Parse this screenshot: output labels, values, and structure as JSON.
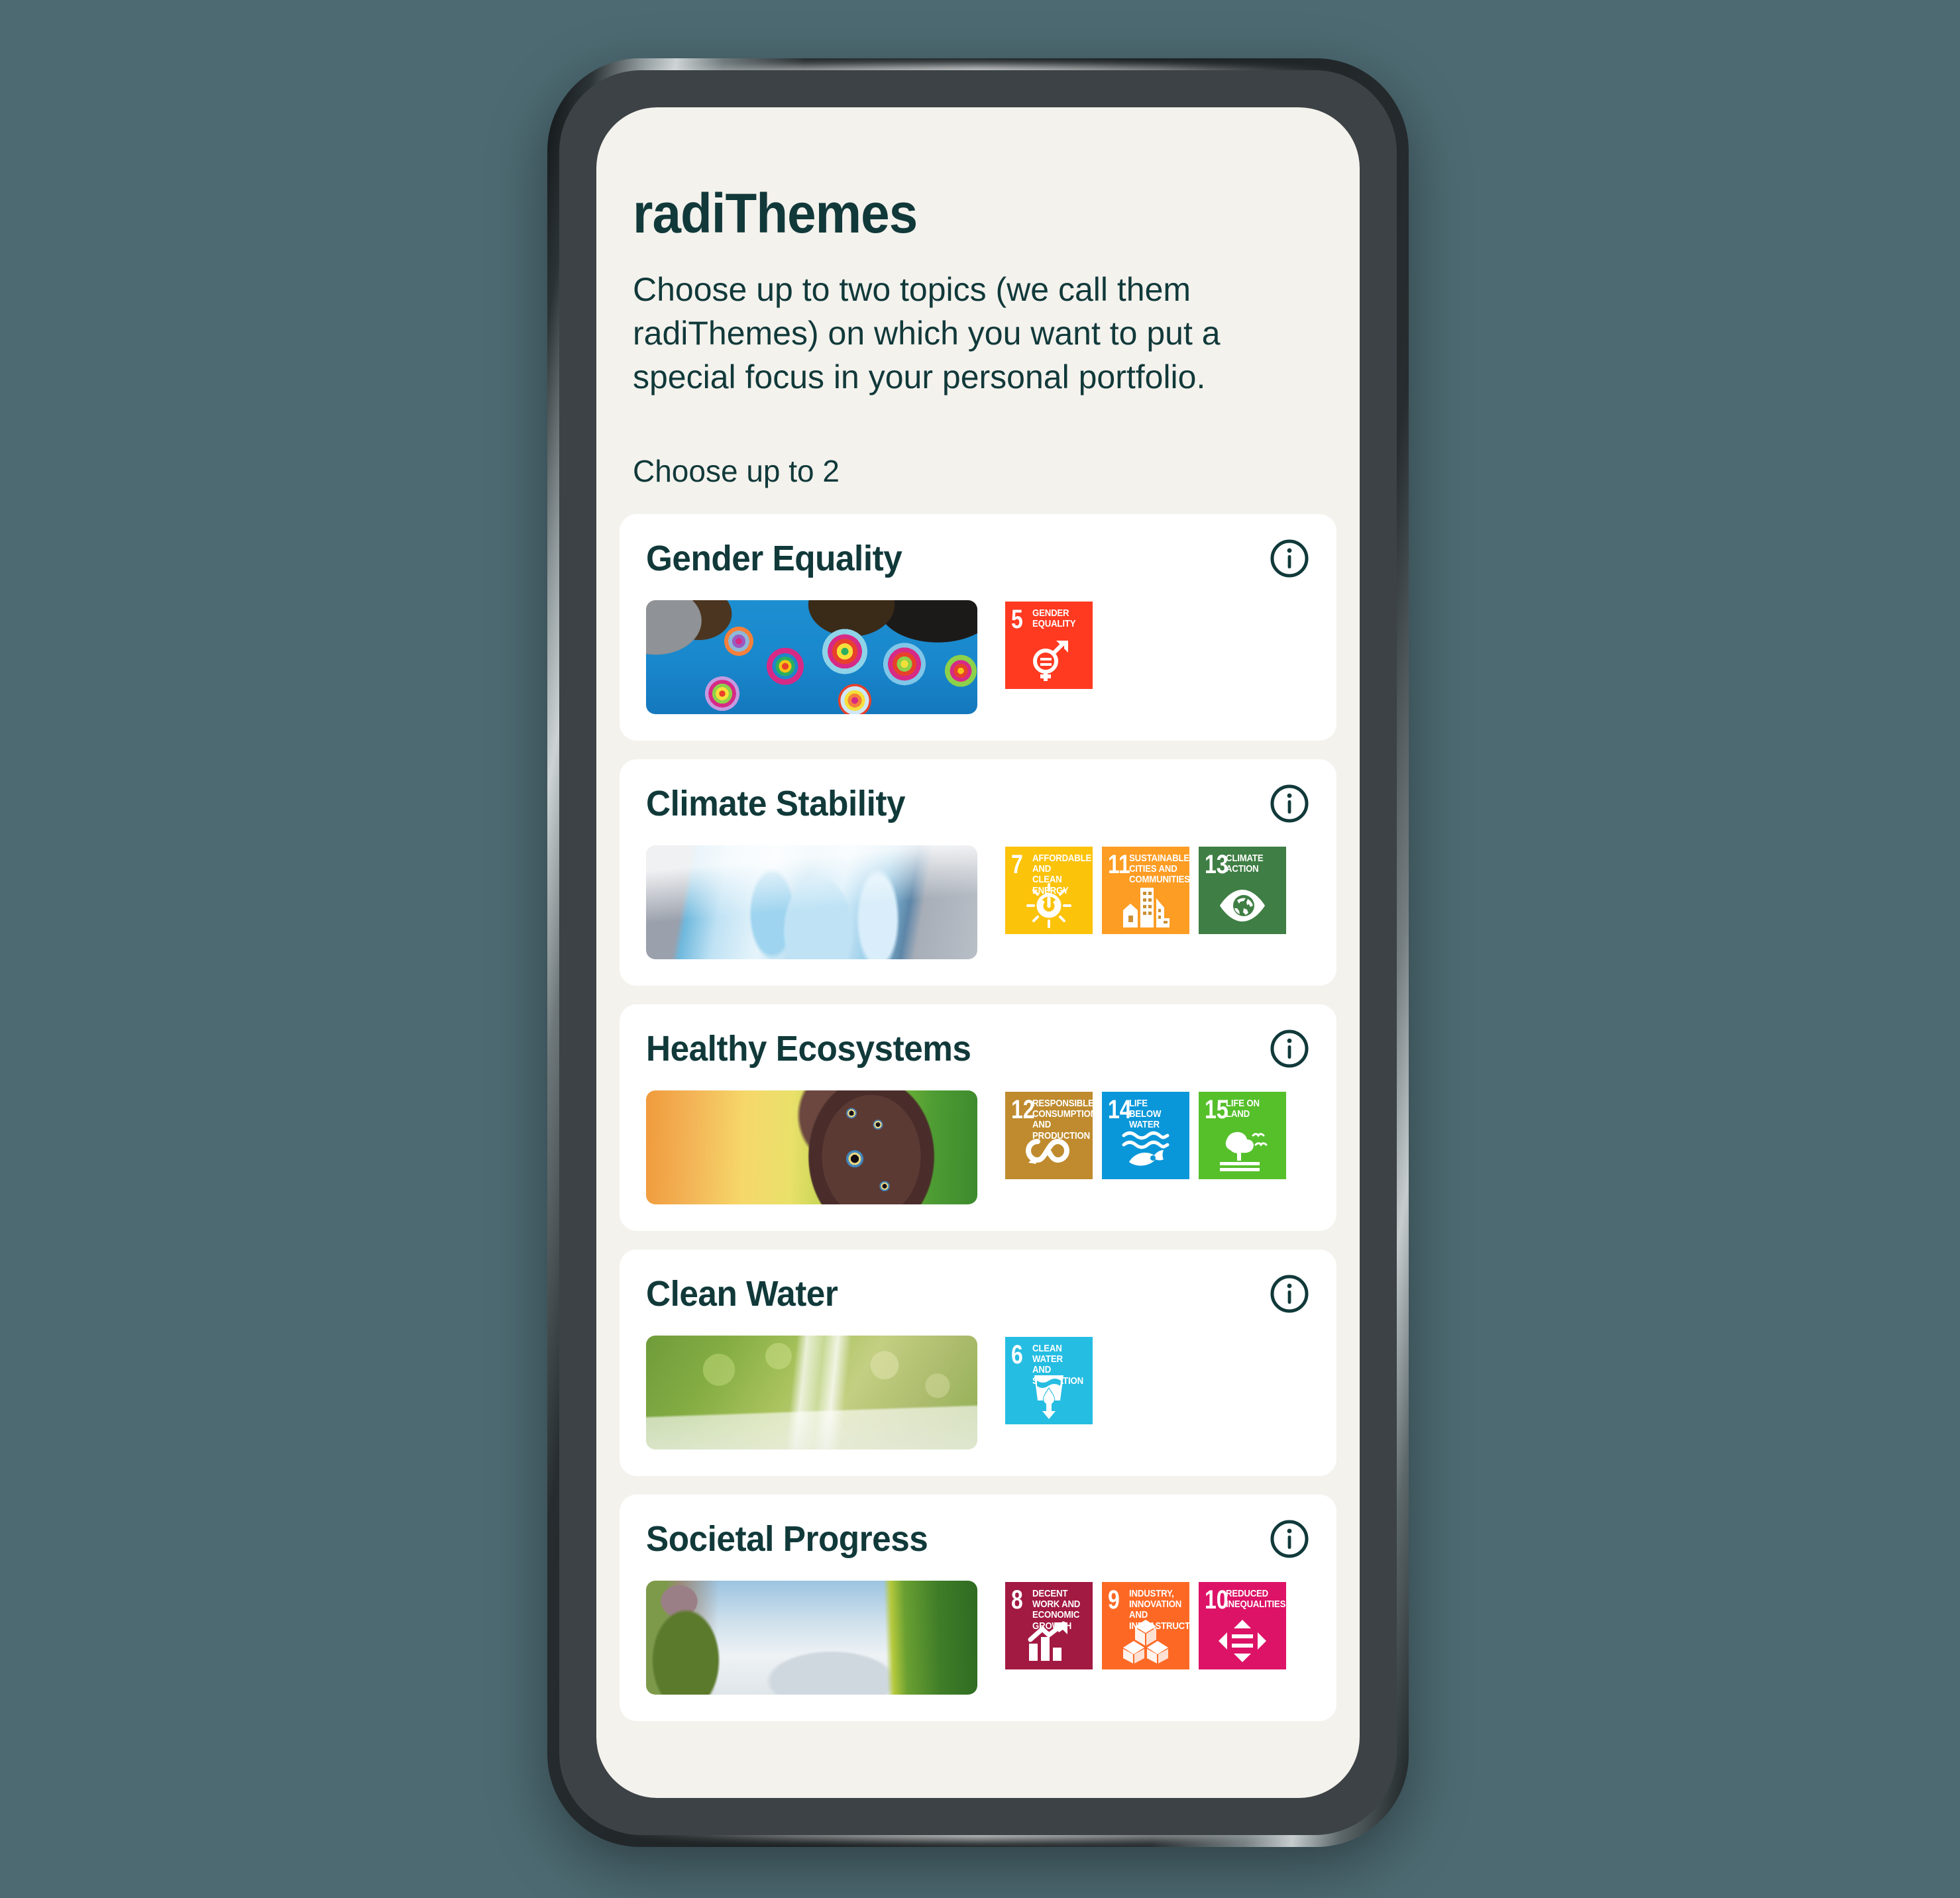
{
  "background_color": "#4d6a72",
  "screen_background": "#f4f2ed",
  "accent_color": "#11393a",
  "app": {
    "title": "radiThemes",
    "intro": "Choose up to two topics (we call them radiThemes) on which you want to put a special focus in your personal portfolio.",
    "choose_label": "Choose up to 2",
    "max_selection": 2
  },
  "info_icon_name": "info-icon",
  "cards": [
    {
      "title": "Gender Equality",
      "photo_name": "colorful-umbrellas-photo",
      "photo_alt": "Colorful umbrellas hanging against blue sky",
      "info_label": "i",
      "sdgs": [
        {
          "number": "5",
          "label": "GENDER EQUALITY",
          "color": "#ff3a21",
          "glyph": "gender-equality-icon"
        }
      ]
    },
    {
      "title": "Climate Stability",
      "photo_name": "iceberg-photo",
      "photo_alt": "Iceberg in cold water under grey sky",
      "info_label": "i",
      "sdgs": [
        {
          "number": "7",
          "label": "AFFORDABLE AND CLEAN ENERGY",
          "color": "#fcc30b",
          "glyph": "sun-power-icon"
        },
        {
          "number": "11",
          "label": "SUSTAINABLE CITIES AND COMMUNITIES",
          "color": "#fd9d24",
          "glyph": "city-buildings-icon"
        },
        {
          "number": "13",
          "label": "CLIMATE ACTION",
          "color": "#3f7e44",
          "glyph": "eye-globe-icon"
        }
      ]
    },
    {
      "title": "Healthy Ecosystems",
      "photo_name": "butterfly-photo",
      "photo_alt": "Owl butterfly on orange and green background",
      "info_label": "i",
      "sdgs": [
        {
          "number": "12",
          "label": "RESPONSIBLE CONSUMPTION AND PRODUCTION",
          "color": "#bf8b2e",
          "glyph": "infinity-loop-icon"
        },
        {
          "number": "14",
          "label": "LIFE BELOW WATER",
          "color": "#0a97d9",
          "glyph": "fish-waves-icon"
        },
        {
          "number": "15",
          "label": "LIFE ON LAND",
          "color": "#56c02b",
          "glyph": "tree-birds-icon"
        }
      ]
    },
    {
      "title": "Clean Water",
      "photo_name": "pouring-water-photo",
      "photo_alt": "Water poured into a glass with green background",
      "info_label": "i",
      "sdgs": [
        {
          "number": "6",
          "label": "CLEAN WATER AND SANITATION",
          "color": "#26bde2",
          "glyph": "water-glass-icon"
        }
      ]
    },
    {
      "title": "Societal Progress",
      "photo_name": "supertree-grove-photo",
      "photo_alt": "Supertree grove with green vertical gardens",
      "info_label": "i",
      "sdgs": [
        {
          "number": "8",
          "label": "DECENT WORK AND ECONOMIC GROWTH",
          "color": "#a21942",
          "glyph": "growth-chart-icon"
        },
        {
          "number": "9",
          "label": "INDUSTRY, INNOVATION AND INFRASTRUCTURE",
          "color": "#fd6925",
          "glyph": "cubes-icon"
        },
        {
          "number": "10",
          "label": "REDUCED INEQUALITIES",
          "color": "#dd1367",
          "glyph": "equal-arrows-icon"
        }
      ]
    }
  ]
}
